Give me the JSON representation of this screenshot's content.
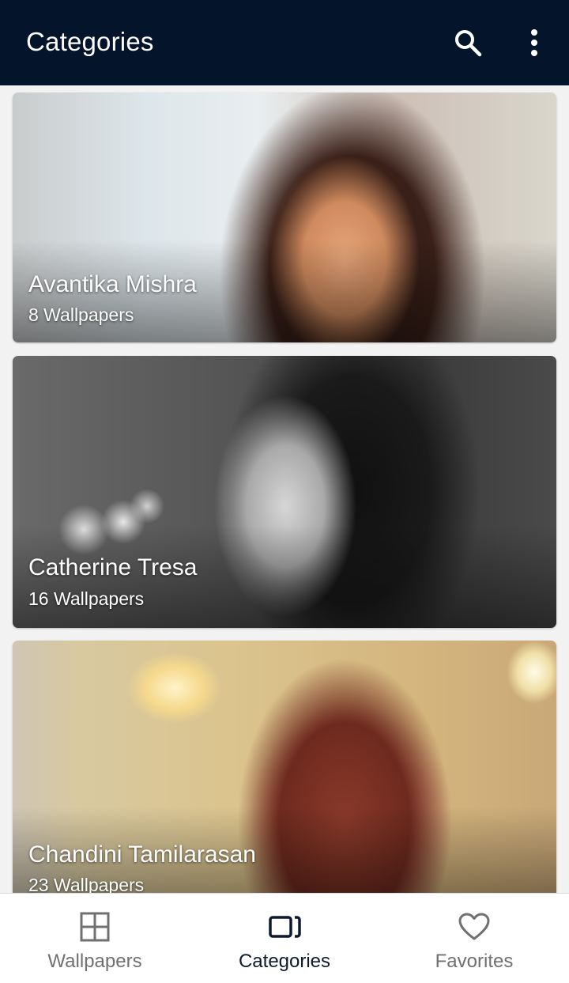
{
  "appbar": {
    "title": "Categories",
    "icons": [
      "search-icon",
      "more-vert-icon"
    ]
  },
  "categories": [
    {
      "name": "Avantika Mishra",
      "count": "8 Wallpapers"
    },
    {
      "name": "Catherine Tresa",
      "count": "16 Wallpapers"
    },
    {
      "name": "Chandini Tamilarasan",
      "count": "23 Wallpapers"
    }
  ],
  "bottom_nav": {
    "items": [
      {
        "label": "Wallpapers",
        "icon": "grid-icon",
        "active": false
      },
      {
        "label": "Categories",
        "icon": "categories-icon",
        "active": true
      },
      {
        "label": "Favorites",
        "icon": "heart-icon",
        "active": false
      }
    ]
  },
  "colors": {
    "appbar_bg": "#04142a",
    "nav_active": "#0d1a2e",
    "nav_inactive": "#707070"
  }
}
